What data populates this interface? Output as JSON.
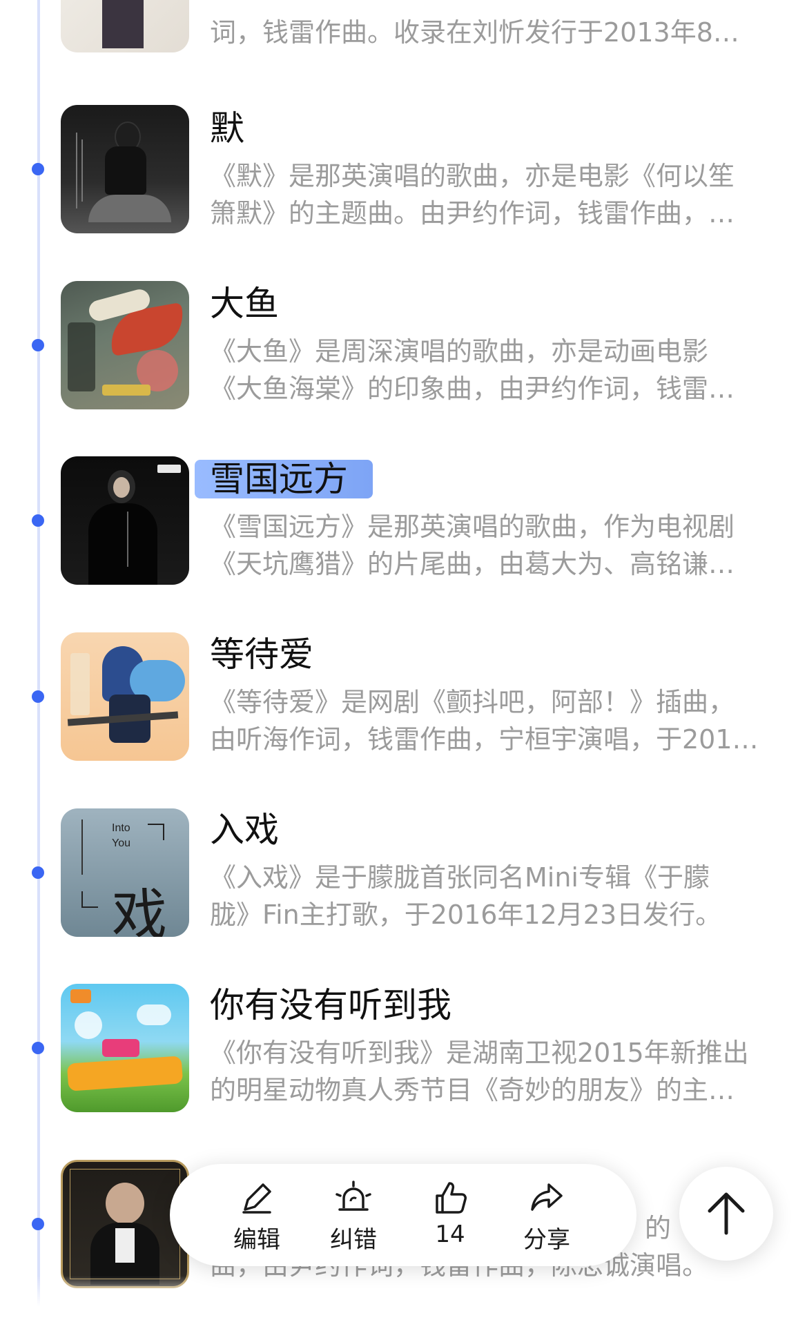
{
  "top_partial": {
    "desc": "词，钱雷作曲。收录在刘忻发行于2013年8…"
  },
  "songs": [
    {
      "title": "默",
      "desc_line1": "《默》是那英演唱的歌曲，亦是电影《何以笙",
      "desc_line2": "箫默》的主题曲。由尹约作词，钱雷作曲，…"
    },
    {
      "title": "大鱼",
      "desc_line1": "《大鱼》是周深演唱的歌曲，亦是动画电影",
      "desc_line2": "《大鱼海棠》的印象曲，由尹约作词，钱雷…"
    },
    {
      "title": "雪国远方",
      "desc_line1": "《雪国远方》是那英演唱的歌曲，作为电视剧",
      "desc_line2": "《天坑鹰猎》的片尾曲，由葛大为、高铭谦…"
    },
    {
      "title": "等待爱",
      "desc_line1": "《等待爱》是网剧《颤抖吧，阿部！》插曲，",
      "desc_line2": "由听海作词，钱雷作曲，宁桓宇演唱，于201…"
    },
    {
      "title": "入戏",
      "desc_line1": "《入戏》是于朦胧首张同名Mini专辑《于朦",
      "desc_line2": "胧》Fin主打歌，于2016年12月23日发行。",
      "thumb_text_en1": "Into",
      "thumb_text_en2": "You",
      "thumb_text_cn": "戏"
    },
    {
      "title": "你有没有听到我",
      "desc_line1": "《你有没有听到我》是湖南卫视2015年新推出",
      "desc_line2": "的明星动物真人秀节目《奇妙的朋友》的主…"
    },
    {
      "title": "",
      "desc_line1": "的",
      "desc_line2": "曲，由尹约作词，钱雷作曲，陈忠诚演唱。"
    }
  ],
  "actions": {
    "edit": "编辑",
    "report": "纠错",
    "like_count": "14",
    "share": "分享"
  },
  "colors": {
    "accent": "#3a66f3",
    "timeline": "#d9e0fb",
    "highlight": "#7aa3f7"
  }
}
